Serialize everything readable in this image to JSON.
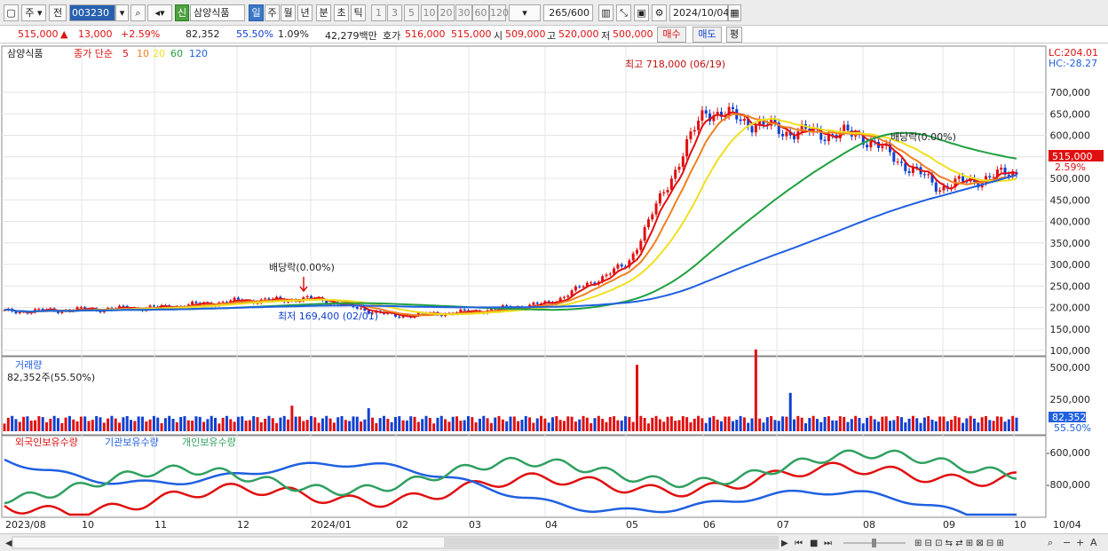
{
  "toolbar": {
    "market_type": "주",
    "prev_label": "전",
    "stock_code": "003230",
    "credit_badge": "신",
    "stock_name": "삼양식품",
    "periods": [
      "일",
      "주",
      "월",
      "년",
      "분",
      "초",
      "틱"
    ],
    "active_period": "일",
    "multipliers": [
      "1",
      "3",
      "5",
      "10",
      "20",
      "30",
      "60",
      "120"
    ],
    "count": "265",
    "count_total": "/600",
    "date": "2024/10/04"
  },
  "quote": {
    "price": "515,000",
    "change_arrow": "▲",
    "change": "13,000",
    "change_pct": "+2.59%",
    "volume": "82,352",
    "volume_ratio": "55.50%",
    "turnover": "1.09%",
    "trade_value": "42,279백만",
    "hoga_label": "호가",
    "ask": "516,000",
    "bid": "515,000",
    "open_label": "시",
    "open": "509,000",
    "high_label": "고",
    "high": "520,000",
    "low_label": "저",
    "low": "500,000",
    "buy_label": "매수",
    "sell_label": "매도",
    "eval_label": "평"
  },
  "price_panel": {
    "stock_name": "삼양식품",
    "legend_title": "종가 단순",
    "ma_labels": [
      "5",
      "10",
      "20",
      "60",
      "120"
    ],
    "ma_colors": [
      "#e01010",
      "#f08020",
      "#f0e020",
      "#20a040",
      "#2060e0"
    ],
    "lc_label": "LC:204.01",
    "hc_label": "HC:-28.27",
    "axis_ticks": [
      "700,000",
      "650,000",
      "600,000",
      "550,000",
      "500,000",
      "450,000",
      "400,000",
      "350,000",
      "300,000",
      "250,000",
      "200,000",
      "150,000",
      "100,000"
    ],
    "current_price_tag": "515,000",
    "current_pct_tag": "2.59%",
    "annotation_high": "최고 718,000 (06/19)",
    "annotation_low": "최저 169,400 (02/01)",
    "annotation_div1": "배당락(0.00%)",
    "annotation_div2": "배당락(0.00%)"
  },
  "volume_panel": {
    "title": "거래량",
    "value_label": "82,352주(55.50%)",
    "axis_ticks": [
      "500,000",
      "250,000"
    ],
    "current_tag": "82,352",
    "current_pct_tag": "55.50%"
  },
  "holdings_panel": {
    "legend": [
      "외국인보유수량",
      "기관보유수량",
      "개인보유수량"
    ],
    "colors": [
      "#e01010",
      "#2060e0",
      "#30a060"
    ],
    "axis_ticks": [
      "-600,000",
      "-800,000"
    ]
  },
  "time_axis": [
    "2023/08",
    "10",
    "11",
    "12",
    "2024/01",
    "02",
    "03",
    "04",
    "05",
    "06",
    "07",
    "08",
    "09",
    "10",
    "10/04"
  ],
  "chart_data": {
    "type": "line",
    "title": "",
    "series": [
      {
        "name": "종가",
        "monthly_close": [
          190000,
          195000,
          200000,
          215000,
          220000,
          180000,
          190000,
          210000,
          300000,
          660000,
          610000,
          600000,
          480000,
          515000
        ]
      }
    ],
    "ylim": [
      100000,
      750000
    ],
    "high": 718000,
    "high_date": "06/19",
    "low": 169400,
    "low_date": "02/01"
  }
}
